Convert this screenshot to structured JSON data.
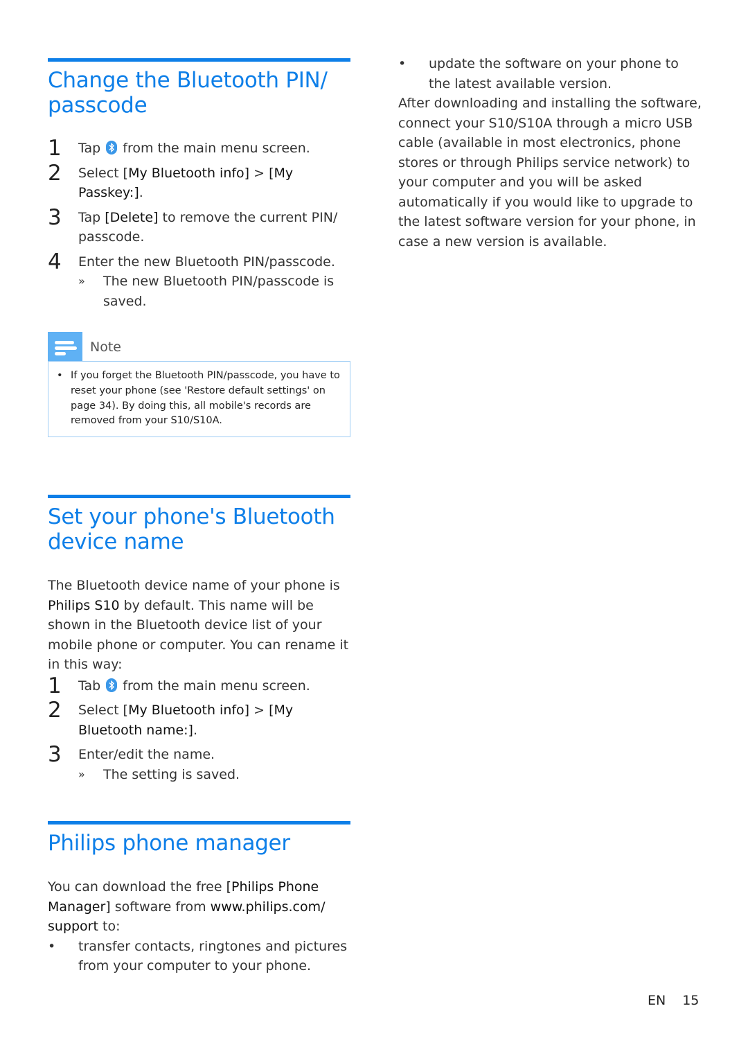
{
  "section1": {
    "title": "Change the Bluetooth PIN/ passcode",
    "steps": [
      {
        "num": "1",
        "pre": "Tap",
        "icon": "bluetooth-icon",
        "post": "from the main menu screen."
      },
      {
        "num": "2",
        "pre": "Select",
        "b1": "[My Bluetooth info]",
        "mid": ">",
        "b2": "[My Passkey:]",
        "post": "."
      },
      {
        "num": "3",
        "pre": "Tap",
        "b1": "[Delete]",
        "post": "to remove the current PIN/ passcode."
      },
      {
        "num": "4",
        "text": "Enter the new Bluetooth PIN/passcode.",
        "result_marker": "»",
        "result": "The new Bluetooth PIN/passcode is saved."
      }
    ],
    "note": {
      "label": "Note",
      "items": [
        "If you forget the Bluetooth PIN/passcode, you have to reset your phone (see 'Restore default settings' on page 34). By doing this, all mobile's records are removed from your S10/S10A."
      ]
    }
  },
  "section2": {
    "title": "Set your phone's Bluetooth device name",
    "intro_b": "Philips S10",
    "intro_1": "The Bluetooth device name of your phone is",
    "intro_2": "by default. This name will be shown in the Bluetooth device list of your mobile phone or computer. You can rename it in this way:",
    "steps": [
      {
        "num": "1",
        "pre": "Tab",
        "icon": "bluetooth-icon",
        "post": "from the main menu screen."
      },
      {
        "num": "2",
        "pre": "Select",
        "b1": "[My Bluetooth info]",
        "mid": ">",
        "b2": "[My Bluetooth name:]",
        "post": "."
      },
      {
        "num": "3",
        "text": "Enter/edit the name.",
        "result_marker": "»",
        "result": "The setting is saved."
      }
    ]
  },
  "section3": {
    "title": "Philips phone manager",
    "intro_1": "You can download the free",
    "intro_b1": "[Philips Phone Manager]",
    "intro_2": "software from",
    "intro_b2": "www.philips.com/ support",
    "intro_3": "to:",
    "bullets": [
      "transfer contacts, ringtones and pictures from your computer to your phone.",
      "update the software on your phone to the latest available version."
    ],
    "closing": "After downloading and installing the software, connect your S10/S10A through a micro USB cable (available in most electronics, phone stores or through Philips service network) to your computer and you will be asked automatically if you would like to upgrade to the latest software version for your phone, in case a new version is available."
  },
  "footer": {
    "lang": "EN",
    "page": "15"
  },
  "colors": {
    "accent": "#0e7fe8",
    "note_icon": "#5fb1f4",
    "note_border": "#9fcdf5"
  }
}
